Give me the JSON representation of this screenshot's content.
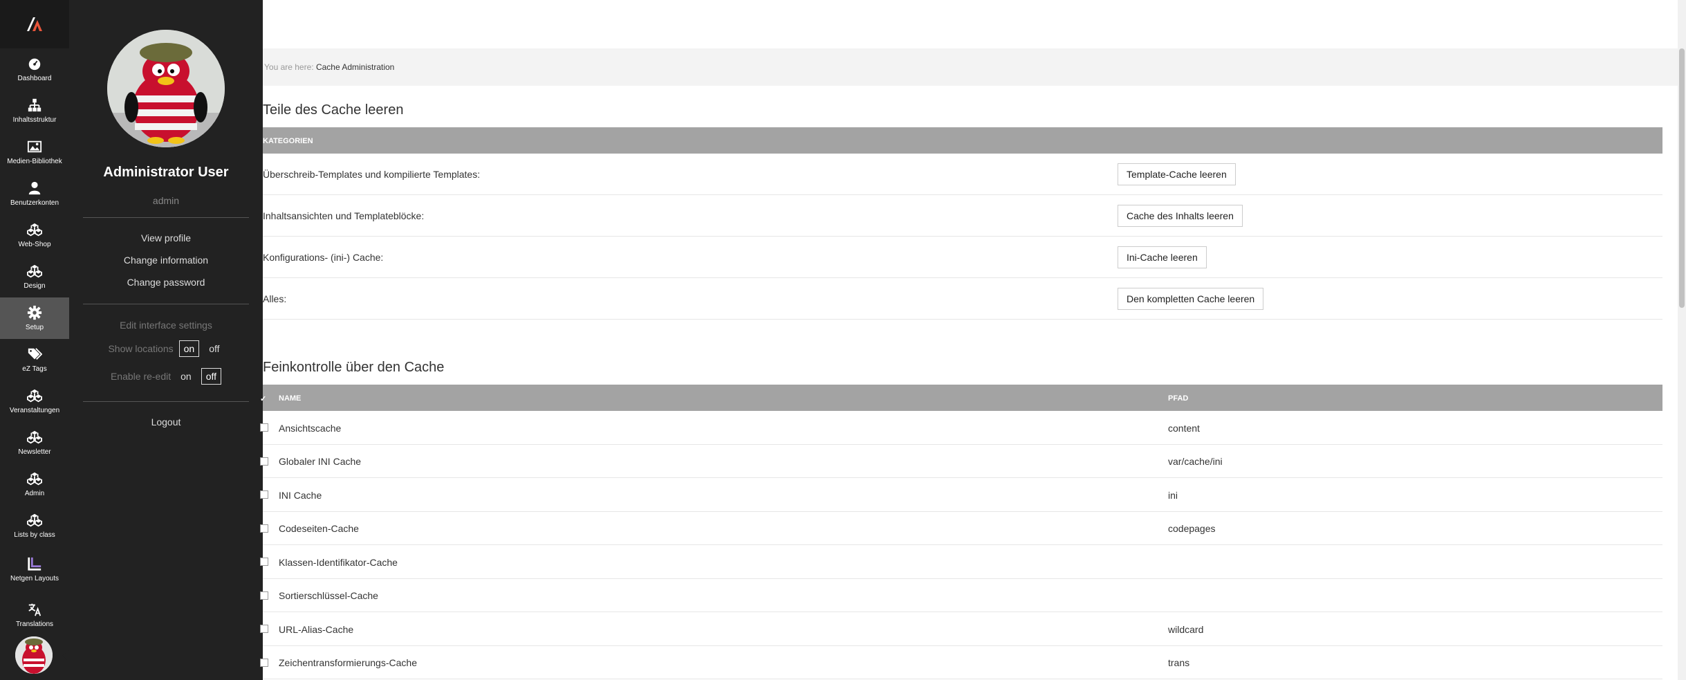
{
  "rail": {
    "items": [
      {
        "label": "Dashboard",
        "icon": "dashboard-icon"
      },
      {
        "label": "Inhaltsstruktur",
        "icon": "sitemap-icon"
      },
      {
        "label": "Medien-Bibliothek",
        "icon": "image-icon"
      },
      {
        "label": "Benutzerkonten",
        "icon": "user-icon"
      },
      {
        "label": "Web-Shop",
        "icon": "cubes-icon"
      },
      {
        "label": "Design",
        "icon": "cubes-icon"
      },
      {
        "label": "Setup",
        "icon": "gear-icon"
      },
      {
        "label": "eZ Tags",
        "icon": "tags-icon"
      },
      {
        "label": "Veranstaltungen",
        "icon": "cubes-icon"
      },
      {
        "label": "Newsletter",
        "icon": "cubes-icon"
      },
      {
        "label": "Admin",
        "icon": "cubes-icon"
      },
      {
        "label": "Lists by class",
        "icon": "cubes-icon"
      },
      {
        "label": "Netgen Layouts",
        "icon": "layouts-icon"
      },
      {
        "label": "Translations",
        "icon": "translate-icon"
      }
    ],
    "active": "Setup"
  },
  "user_panel": {
    "name": "Administrator User",
    "login": "admin",
    "view_profile": "View profile",
    "change_information": "Change information",
    "change_password": "Change password",
    "edit_interface_settings": "Edit interface settings",
    "show_locations_label": "Show locations",
    "show_locations_on": "on",
    "show_locations_off": "off",
    "enable_reedit_label": "Enable re-edit",
    "enable_reedit_on": "on",
    "enable_reedit_off": "off",
    "logout": "Logout"
  },
  "breadcrumb": {
    "prefix": "You are here:",
    "current": "Cache Administration"
  },
  "clear_section": {
    "title": "Teile des Cache leeren",
    "header": "Kategorien",
    "rows": [
      {
        "label": "Überschreib-Templates und kompilierte Templates:",
        "button": "Template-Cache leeren"
      },
      {
        "label": "Inhaltsansichten und Templateblöcke:",
        "button": "Cache des Inhalts leeren"
      },
      {
        "label": "Konfigurations- (ini-) Cache:",
        "button": "Ini-Cache leeren"
      },
      {
        "label": "Alles:",
        "button": "Den kompletten Cache leeren"
      }
    ]
  },
  "fine_section": {
    "title": "Feinkontrolle über den Cache",
    "col_name": "Name",
    "col_path": "Pfad",
    "rows": [
      {
        "name": "Ansichtscache",
        "path": "content"
      },
      {
        "name": "Globaler INI Cache",
        "path": "var/cache/ini"
      },
      {
        "name": "INI Cache",
        "path": "ini"
      },
      {
        "name": "Codeseiten-Cache",
        "path": "codepages"
      },
      {
        "name": "Klassen-Identifikator-Cache",
        "path": ""
      },
      {
        "name": "Sortierschlüssel-Cache",
        "path": ""
      },
      {
        "name": "URL-Alias-Cache",
        "path": "wildcard"
      },
      {
        "name": "Zeichentransformierungs-Cache",
        "path": "trans"
      }
    ]
  }
}
